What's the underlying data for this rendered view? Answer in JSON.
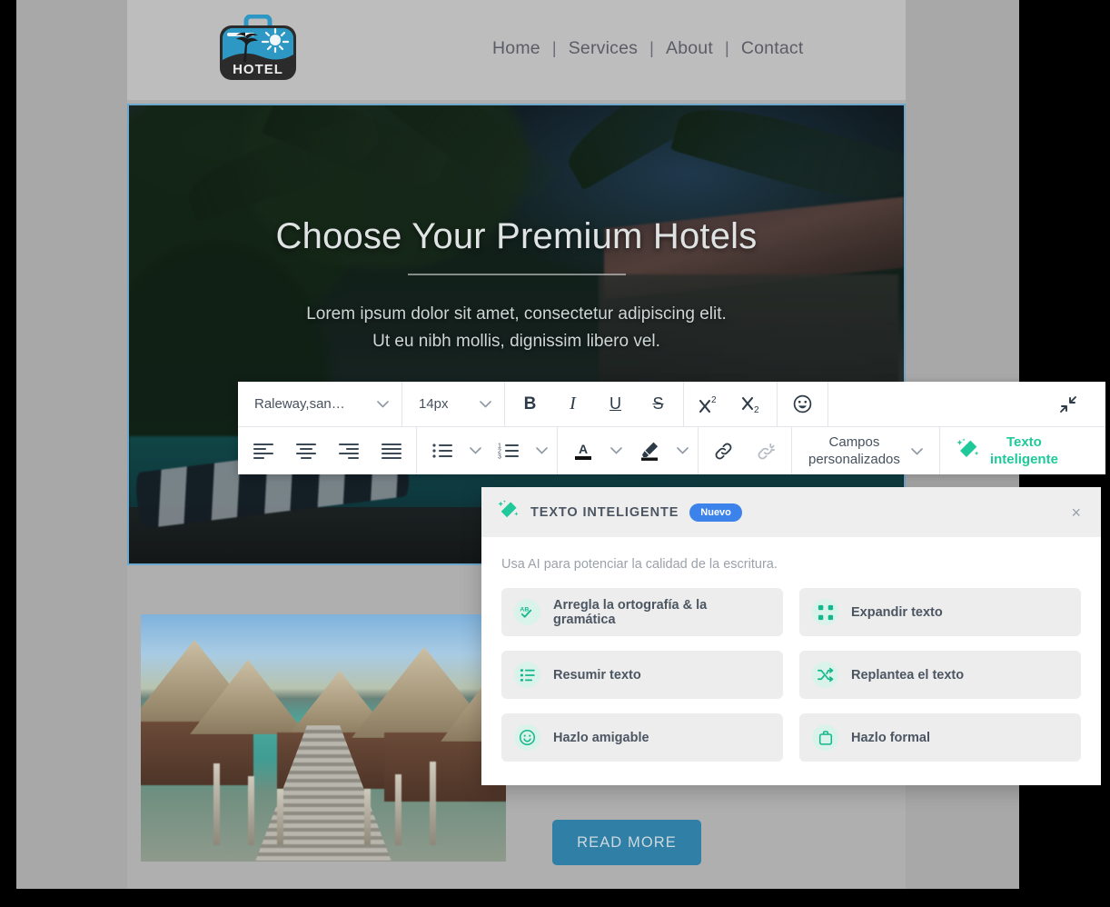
{
  "site": {
    "logo": {
      "alt": "hotel-logo",
      "caption": "HOTEL"
    },
    "nav": [
      {
        "label": "Home"
      },
      {
        "label": "Services"
      },
      {
        "label": "About"
      },
      {
        "label": "Contact"
      }
    ],
    "nav_separator": "|",
    "hero": {
      "title": "Choose Your Premium Hotels",
      "subtitle_line1": "Lorem ipsum dolor sit amet, consectetur adipiscing elit.",
      "subtitle_line2": "Ut eu nibh mollis, dignissim libero vel."
    },
    "read_more_label": "READ MORE",
    "colors": {
      "button_blue": "#2f7fa6",
      "header_gray": "#bdbdbd",
      "page_gray": "#afafaf",
      "backdrop_gray": "#a8a8a8"
    }
  },
  "toolbar": {
    "font_family_value": "Raleway,san…",
    "font_size_value": "14px",
    "bold": "B",
    "italic": "I",
    "underline": "U",
    "strikethrough": "S",
    "superscript": "x²",
    "subscript": "x₂",
    "emoji": "emoji",
    "collapse": "collapse",
    "align_left": "align-left",
    "align_center": "align-center",
    "align_right": "align-right",
    "align_justify": "align-justify",
    "bullet_list": "bullet-list",
    "numbered_list": "numbered-list",
    "text_color": "A",
    "highlight_color": "highlight",
    "link": "link",
    "unlink": "unlink",
    "custom_fields_line1": "Campos",
    "custom_fields_line2": "personalizados",
    "smart_text_line1": "Texto",
    "smart_text_line2": "inteligente",
    "smart_text_color": "#1fc99a"
  },
  "popup": {
    "title": "TEXTO INTELIGENTE",
    "badge": "Nuevo",
    "badge_color": "#3b82ea",
    "close": "×",
    "description": "Usa AI para potenciar la calidad de la escritura.",
    "options": [
      {
        "label": "Arregla la ortografía & la gramática",
        "icon": "spellcheck-icon"
      },
      {
        "label": "Expandir texto",
        "icon": "expand-icon"
      },
      {
        "label": "Resumir texto",
        "icon": "summary-list-icon"
      },
      {
        "label": "Replantea el texto",
        "icon": "shuffle-icon"
      },
      {
        "label": "Hazlo amigable",
        "icon": "smiley-icon"
      },
      {
        "label": "Hazlo formal",
        "icon": "briefcase-icon"
      }
    ]
  }
}
